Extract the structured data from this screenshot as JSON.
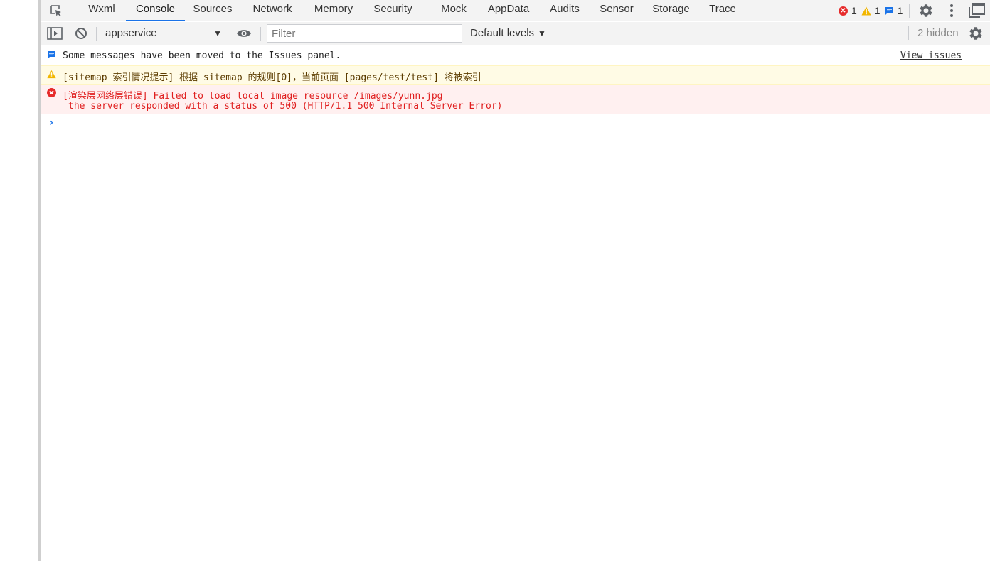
{
  "tabs": [
    {
      "label": "Wxml"
    },
    {
      "label": "Console"
    },
    {
      "label": "Sources"
    },
    {
      "label": "Network"
    },
    {
      "label": "Memory"
    },
    {
      "label": "Security"
    },
    {
      "label": "Mock"
    },
    {
      "label": "AppData"
    },
    {
      "label": "Audits"
    },
    {
      "label": "Sensor"
    },
    {
      "label": "Storage"
    },
    {
      "label": "Trace"
    }
  ],
  "active_tab": "Console",
  "counters": {
    "errors": "1",
    "warnings": "1",
    "issues": "1"
  },
  "toolbar": {
    "context": "appservice",
    "filter_placeholder": "Filter",
    "filter_value": "",
    "levels": "Default levels",
    "hidden": "2 hidden"
  },
  "messages": {
    "info": {
      "text": "Some messages have been moved to the Issues panel.",
      "link": "View issues"
    },
    "warning": {
      "text": "[sitemap 索引情况提示] 根据 sitemap 的规则[0]，当前页面 [pages/test/test] 将被索引"
    },
    "error": {
      "line1": "[渲染层网络层错误] Failed to load local image resource /images/yunn.jpg",
      "line2": "the server responded with a status of 500 (HTTP/1.1 500 Internal Server Error)"
    }
  },
  "prompt_symbol": "›",
  "colors": {
    "accent": "#1a73e8",
    "error": "#e62b2b",
    "warning": "#f2b600",
    "warning_bg": "#fffbe5",
    "error_bg": "#fff0f0"
  }
}
